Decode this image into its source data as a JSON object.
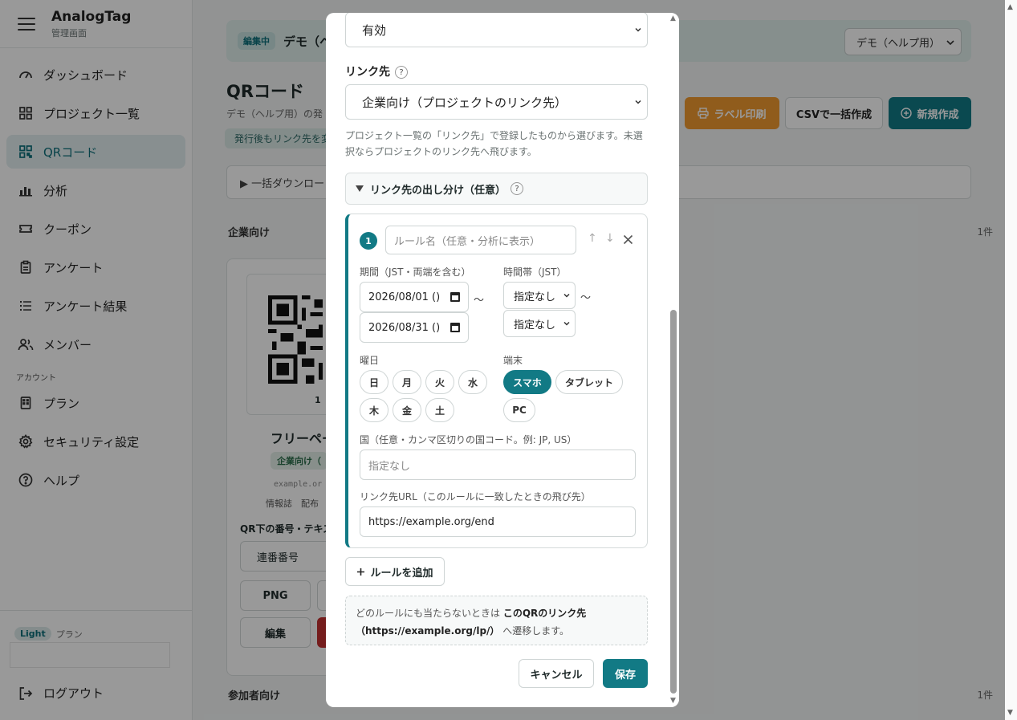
{
  "app": {
    "name": "AnalogTag",
    "subtitle": "管理画面"
  },
  "sidebar": {
    "items": [
      {
        "label": "ダッシュボード",
        "icon": "gauge-icon"
      },
      {
        "label": "プロジェクト一覧",
        "icon": "grid-icon"
      },
      {
        "label": "QRコード",
        "icon": "qr-icon",
        "active": true
      },
      {
        "label": "分析",
        "icon": "bar-chart-icon"
      },
      {
        "label": "クーポン",
        "icon": "ticket-icon"
      },
      {
        "label": "アンケート",
        "icon": "clipboard-icon"
      },
      {
        "label": "アンケート結果",
        "icon": "list-icon"
      },
      {
        "label": "メンバー",
        "icon": "users-icon"
      }
    ],
    "section_account": "アカウント",
    "account_items": [
      {
        "label": "プラン",
        "icon": "building-icon"
      },
      {
        "label": "セキュリティ設定",
        "icon": "gear-icon"
      },
      {
        "label": "ヘルプ",
        "icon": "help-circle-icon"
      }
    ],
    "plan_badge": "Light",
    "plan_label": "プラン",
    "logout": "ログアウト"
  },
  "background": {
    "edit_badge": "編集中",
    "edit_title": "デモ（ヘ",
    "project_select": "デモ（ヘルプ用）",
    "page_title": "QRコード",
    "page_desc": "デモ（ヘルプ用）の発",
    "notice": "発行後もリンク先を変",
    "btn_label_print": "ラベル印刷",
    "btn_csv": "CSVで一括作成",
    "btn_new": "新規作成",
    "bulk_download": "▶ 一括ダウンロー",
    "group1_title": "企業向け",
    "group1_count": "1件",
    "group2_title": "参加者向け",
    "group2_count": "1件",
    "card": {
      "qr_number": "1",
      "title": "フリーペー",
      "tag": "企業向け（",
      "url": "example.or",
      "meta": "情報誌　配布",
      "number_text_label": "QR下の番号・テキス",
      "number_select": "連番番号",
      "btn_png": "PNG",
      "btn_edit": "編集"
    }
  },
  "modal": {
    "status_select": "有効",
    "link_label": "リンク先",
    "help_mark": "?",
    "link_select": "企業向け（プロジェクトのリンク先）",
    "link_hint": "プロジェクト一覧の「リンク先」で登録したものから選びます。未選択ならプロジェクトのリンク先へ飛びます。",
    "branch_toggle": "リンク先の出し分け（任意）",
    "rule": {
      "number": "1",
      "name_placeholder": "ルール名（任意・分析に表示）",
      "period_label": "期間（JST・両端を含む）",
      "date_from": "2026/08/01 ()",
      "date_to": "2026/08/31 ()",
      "time_label": "時間帯（JST）",
      "time_from": "指定なし",
      "time_to": "指定なし",
      "tilde": "～",
      "weekday_label": "曜日",
      "weekdays": [
        "日",
        "月",
        "火",
        "水",
        "木",
        "金",
        "土"
      ],
      "device_label": "端末",
      "devices": [
        {
          "label": "スマホ",
          "selected": true
        },
        {
          "label": "タブレット",
          "selected": false
        },
        {
          "label": "PC",
          "selected": false
        }
      ],
      "country_label": "国（任意・カンマ区切りの国コード。例: JP, US）",
      "country_placeholder": "指定なし",
      "url_label": "リンク先URL（このルールに一致したときの飛び先）",
      "url_value": "https://example.org/end"
    },
    "add_rule": "ルールを追加",
    "fallback_prefix": "どのルールにも当たらないときは",
    "fallback_bold": "このQRのリンク先（https://example.org/lp/）",
    "fallback_suffix": "へ遷移します。",
    "cancel": "キャンセル",
    "save": "保存"
  },
  "colors": {
    "accent": "#127a85",
    "orange": "#f09a2f"
  }
}
